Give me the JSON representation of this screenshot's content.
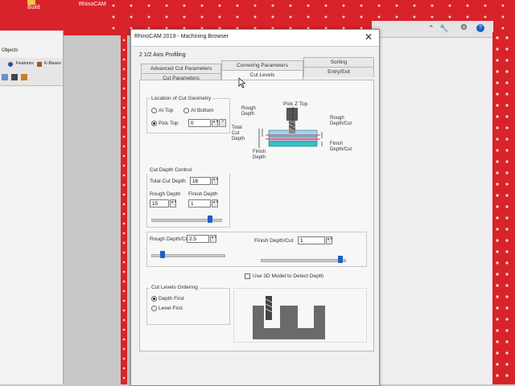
{
  "app": {
    "title": "RhinoCAM",
    "subtitle": "Build"
  },
  "left_panel": {
    "title": "Objects",
    "tools": [
      "Features",
      "K-Bases"
    ]
  },
  "dialog": {
    "title": "RhinoCAM 2019 - Machining Browser",
    "subtitle": "2 1/2 Axis Profiling",
    "tabs_row1": [
      "Advanced Cut Parameters",
      "Cornering Parameters",
      "Sorting"
    ],
    "tabs_row2": [
      "Cut Parameters",
      "Cut Levels",
      "Entry/Exit"
    ],
    "active_tab": "Cut Levels",
    "location": {
      "title": "Location of Cut Geometry",
      "options": [
        "At Top",
        "At Bottom",
        "Pick Top"
      ],
      "selected": "Pick Top",
      "pick_top_value": "0"
    },
    "cut_depth": {
      "title": "Cut Depth Control",
      "total_label": "Total Cut Depth",
      "total_value": "16",
      "rough_label": "Rough Depth",
      "rough_value": "15",
      "finish_label": "Finish Depth",
      "finish_value": "1",
      "slider_fraction": 0.85
    },
    "per_cut": {
      "rough_label": "Rough Depth/Cut",
      "rough_value": "2.5",
      "rough_slider_fraction": 0.15,
      "finish_label": "Finish Depth/Cut",
      "finish_value": "1",
      "finish_slider_fraction": 0.95
    },
    "use_3d_label": "Use 3D Model to Detect Depth",
    "ordering": {
      "title": "Cut Levels Ordering",
      "options": [
        "Depth First",
        "Level First"
      ],
      "selected": "Depth First"
    },
    "diagram_labels": {
      "pick_z_top": "Pick Z Top",
      "rough_depth": "Rough\nDepth",
      "total_cut_depth": "Total\nCut\nDepth",
      "finish_depth": "Finish\nDepth",
      "rough_depth_cut": "Rough\nDepth/Cut",
      "finish_depth_cut": "Finish\nDepth/Cut"
    }
  },
  "colors": {
    "title_red": "#d8232a",
    "slider_blue": "#1f5fc4"
  }
}
